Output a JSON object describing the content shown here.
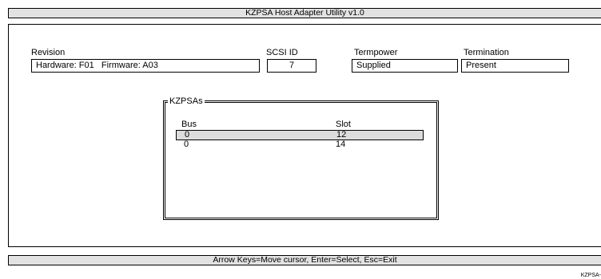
{
  "title_bar": {
    "title": "KZPSA Host Adapter Utility v1.0"
  },
  "fields": {
    "revision": {
      "label": "Revision",
      "value": "Hardware: F01   Firmware: A03"
    },
    "scsi_id": {
      "label": "SCSI ID",
      "value": "7"
    },
    "termpower": {
      "label": "Termpower",
      "value": "Supplied"
    },
    "termination": {
      "label": "Termination",
      "value": "Present"
    }
  },
  "kzpsa_list": {
    "title": "KZPSAs",
    "columns": {
      "bus": "Bus",
      "slot": "Slot"
    },
    "rows": [
      {
        "bus": "0",
        "slot": "12",
        "selected": true
      },
      {
        "bus": "0",
        "slot": "14",
        "selected": false
      }
    ]
  },
  "status_bar": {
    "help_text": "Arrow Keys=Move cursor, Enter=Select, Esc=Exit"
  },
  "corner_tag": "KZPSA-"
}
